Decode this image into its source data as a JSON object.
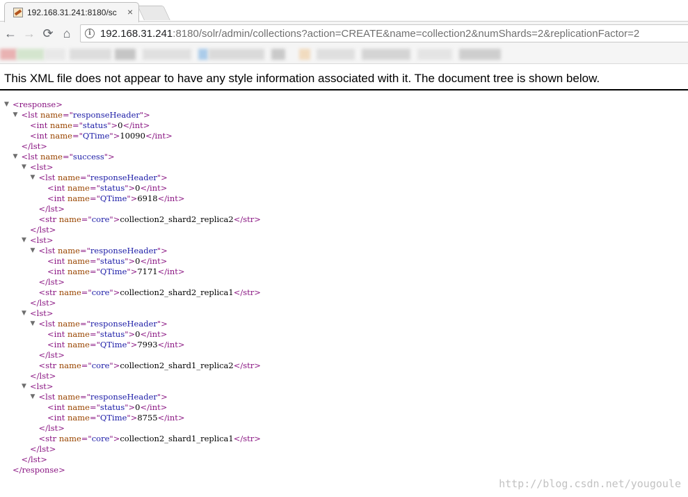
{
  "browser": {
    "tab": {
      "title": "192.168.31.241:8180/sc",
      "close_glyph": "×",
      "favicon": "solr-favicon"
    },
    "nav": {
      "back": "←",
      "forward": "→",
      "reload": "⟳",
      "home": "⌂"
    },
    "address": {
      "host": "192.168.31.241",
      "rest": ":8180/solr/admin/collections?action=CREATE&name=collection2&numShards=2&replicationFactor=2",
      "info_glyph": "i"
    }
  },
  "xml_viewer": {
    "header": "This XML file does not appear to have any style information associated with it. The document tree is shown below.",
    "toggle_glyph": "▼",
    "lines": [
      {
        "depth": 0,
        "toggle": true,
        "parts": [
          {
            "c": "tg",
            "t": "<response>"
          }
        ]
      },
      {
        "depth": 1,
        "toggle": true,
        "parts": [
          {
            "c": "tg",
            "t": "<lst "
          },
          {
            "c": "an",
            "t": "name"
          },
          {
            "c": "tg",
            "t": "=\""
          },
          {
            "c": "av",
            "t": "responseHeader"
          },
          {
            "c": "tg",
            "t": "\">"
          }
        ]
      },
      {
        "depth": 2,
        "toggle": false,
        "parts": [
          {
            "c": "tg",
            "t": "<int "
          },
          {
            "c": "an",
            "t": "name"
          },
          {
            "c": "tg",
            "t": "=\""
          },
          {
            "c": "av",
            "t": "status"
          },
          {
            "c": "tg",
            "t": "\">"
          },
          {
            "c": "tx",
            "t": "0"
          },
          {
            "c": "tg",
            "t": "</int>"
          }
        ]
      },
      {
        "depth": 2,
        "toggle": false,
        "parts": [
          {
            "c": "tg",
            "t": "<int "
          },
          {
            "c": "an",
            "t": "name"
          },
          {
            "c": "tg",
            "t": "=\""
          },
          {
            "c": "av",
            "t": "QTime"
          },
          {
            "c": "tg",
            "t": "\">"
          },
          {
            "c": "tx",
            "t": "10090"
          },
          {
            "c": "tg",
            "t": "</int>"
          }
        ]
      },
      {
        "depth": 1,
        "toggle": false,
        "parts": [
          {
            "c": "tg",
            "t": "</lst>"
          }
        ]
      },
      {
        "depth": 1,
        "toggle": true,
        "parts": [
          {
            "c": "tg",
            "t": "<lst "
          },
          {
            "c": "an",
            "t": "name"
          },
          {
            "c": "tg",
            "t": "=\""
          },
          {
            "c": "av",
            "t": "success"
          },
          {
            "c": "tg",
            "t": "\">"
          }
        ]
      },
      {
        "depth": 2,
        "toggle": true,
        "parts": [
          {
            "c": "tg",
            "t": "<lst>"
          }
        ]
      },
      {
        "depth": 3,
        "toggle": true,
        "parts": [
          {
            "c": "tg",
            "t": "<lst "
          },
          {
            "c": "an",
            "t": "name"
          },
          {
            "c": "tg",
            "t": "=\""
          },
          {
            "c": "av",
            "t": "responseHeader"
          },
          {
            "c": "tg",
            "t": "\">"
          }
        ]
      },
      {
        "depth": 4,
        "toggle": false,
        "parts": [
          {
            "c": "tg",
            "t": "<int "
          },
          {
            "c": "an",
            "t": "name"
          },
          {
            "c": "tg",
            "t": "=\""
          },
          {
            "c": "av",
            "t": "status"
          },
          {
            "c": "tg",
            "t": "\">"
          },
          {
            "c": "tx",
            "t": "0"
          },
          {
            "c": "tg",
            "t": "</int>"
          }
        ]
      },
      {
        "depth": 4,
        "toggle": false,
        "parts": [
          {
            "c": "tg",
            "t": "<int "
          },
          {
            "c": "an",
            "t": "name"
          },
          {
            "c": "tg",
            "t": "=\""
          },
          {
            "c": "av",
            "t": "QTime"
          },
          {
            "c": "tg",
            "t": "\">"
          },
          {
            "c": "tx",
            "t": "6918"
          },
          {
            "c": "tg",
            "t": "</int>"
          }
        ]
      },
      {
        "depth": 3,
        "toggle": false,
        "parts": [
          {
            "c": "tg",
            "t": "</lst>"
          }
        ]
      },
      {
        "depth": 3,
        "toggle": false,
        "parts": [
          {
            "c": "tg",
            "t": "<str "
          },
          {
            "c": "an",
            "t": "name"
          },
          {
            "c": "tg",
            "t": "=\""
          },
          {
            "c": "av",
            "t": "core"
          },
          {
            "c": "tg",
            "t": "\">"
          },
          {
            "c": "tx",
            "t": "collection2_shard2_replica2"
          },
          {
            "c": "tg",
            "t": "</str>"
          }
        ]
      },
      {
        "depth": 2,
        "toggle": false,
        "parts": [
          {
            "c": "tg",
            "t": "</lst>"
          }
        ]
      },
      {
        "depth": 2,
        "toggle": true,
        "parts": [
          {
            "c": "tg",
            "t": "<lst>"
          }
        ]
      },
      {
        "depth": 3,
        "toggle": true,
        "parts": [
          {
            "c": "tg",
            "t": "<lst "
          },
          {
            "c": "an",
            "t": "name"
          },
          {
            "c": "tg",
            "t": "=\""
          },
          {
            "c": "av",
            "t": "responseHeader"
          },
          {
            "c": "tg",
            "t": "\">"
          }
        ]
      },
      {
        "depth": 4,
        "toggle": false,
        "parts": [
          {
            "c": "tg",
            "t": "<int "
          },
          {
            "c": "an",
            "t": "name"
          },
          {
            "c": "tg",
            "t": "=\""
          },
          {
            "c": "av",
            "t": "status"
          },
          {
            "c": "tg",
            "t": "\">"
          },
          {
            "c": "tx",
            "t": "0"
          },
          {
            "c": "tg",
            "t": "</int>"
          }
        ]
      },
      {
        "depth": 4,
        "toggle": false,
        "parts": [
          {
            "c": "tg",
            "t": "<int "
          },
          {
            "c": "an",
            "t": "name"
          },
          {
            "c": "tg",
            "t": "=\""
          },
          {
            "c": "av",
            "t": "QTime"
          },
          {
            "c": "tg",
            "t": "\">"
          },
          {
            "c": "tx",
            "t": "7171"
          },
          {
            "c": "tg",
            "t": "</int>"
          }
        ]
      },
      {
        "depth": 3,
        "toggle": false,
        "parts": [
          {
            "c": "tg",
            "t": "</lst>"
          }
        ]
      },
      {
        "depth": 3,
        "toggle": false,
        "parts": [
          {
            "c": "tg",
            "t": "<str "
          },
          {
            "c": "an",
            "t": "name"
          },
          {
            "c": "tg",
            "t": "=\""
          },
          {
            "c": "av",
            "t": "core"
          },
          {
            "c": "tg",
            "t": "\">"
          },
          {
            "c": "tx",
            "t": "collection2_shard2_replica1"
          },
          {
            "c": "tg",
            "t": "</str>"
          }
        ]
      },
      {
        "depth": 2,
        "toggle": false,
        "parts": [
          {
            "c": "tg",
            "t": "</lst>"
          }
        ]
      },
      {
        "depth": 2,
        "toggle": true,
        "parts": [
          {
            "c": "tg",
            "t": "<lst>"
          }
        ]
      },
      {
        "depth": 3,
        "toggle": true,
        "parts": [
          {
            "c": "tg",
            "t": "<lst "
          },
          {
            "c": "an",
            "t": "name"
          },
          {
            "c": "tg",
            "t": "=\""
          },
          {
            "c": "av",
            "t": "responseHeader"
          },
          {
            "c": "tg",
            "t": "\">"
          }
        ]
      },
      {
        "depth": 4,
        "toggle": false,
        "parts": [
          {
            "c": "tg",
            "t": "<int "
          },
          {
            "c": "an",
            "t": "name"
          },
          {
            "c": "tg",
            "t": "=\""
          },
          {
            "c": "av",
            "t": "status"
          },
          {
            "c": "tg",
            "t": "\">"
          },
          {
            "c": "tx",
            "t": "0"
          },
          {
            "c": "tg",
            "t": "</int>"
          }
        ]
      },
      {
        "depth": 4,
        "toggle": false,
        "parts": [
          {
            "c": "tg",
            "t": "<int "
          },
          {
            "c": "an",
            "t": "name"
          },
          {
            "c": "tg",
            "t": "=\""
          },
          {
            "c": "av",
            "t": "QTime"
          },
          {
            "c": "tg",
            "t": "\">"
          },
          {
            "c": "tx",
            "t": "7993"
          },
          {
            "c": "tg",
            "t": "</int>"
          }
        ]
      },
      {
        "depth": 3,
        "toggle": false,
        "parts": [
          {
            "c": "tg",
            "t": "</lst>"
          }
        ]
      },
      {
        "depth": 3,
        "toggle": false,
        "parts": [
          {
            "c": "tg",
            "t": "<str "
          },
          {
            "c": "an",
            "t": "name"
          },
          {
            "c": "tg",
            "t": "=\""
          },
          {
            "c": "av",
            "t": "core"
          },
          {
            "c": "tg",
            "t": "\">"
          },
          {
            "c": "tx",
            "t": "collection2_shard1_replica2"
          },
          {
            "c": "tg",
            "t": "</str>"
          }
        ]
      },
      {
        "depth": 2,
        "toggle": false,
        "parts": [
          {
            "c": "tg",
            "t": "</lst>"
          }
        ]
      },
      {
        "depth": 2,
        "toggle": true,
        "parts": [
          {
            "c": "tg",
            "t": "<lst>"
          }
        ]
      },
      {
        "depth": 3,
        "toggle": true,
        "parts": [
          {
            "c": "tg",
            "t": "<lst "
          },
          {
            "c": "an",
            "t": "name"
          },
          {
            "c": "tg",
            "t": "=\""
          },
          {
            "c": "av",
            "t": "responseHeader"
          },
          {
            "c": "tg",
            "t": "\">"
          }
        ]
      },
      {
        "depth": 4,
        "toggle": false,
        "parts": [
          {
            "c": "tg",
            "t": "<int "
          },
          {
            "c": "an",
            "t": "name"
          },
          {
            "c": "tg",
            "t": "=\""
          },
          {
            "c": "av",
            "t": "status"
          },
          {
            "c": "tg",
            "t": "\">"
          },
          {
            "c": "tx",
            "t": "0"
          },
          {
            "c": "tg",
            "t": "</int>"
          }
        ]
      },
      {
        "depth": 4,
        "toggle": false,
        "parts": [
          {
            "c": "tg",
            "t": "<int "
          },
          {
            "c": "an",
            "t": "name"
          },
          {
            "c": "tg",
            "t": "=\""
          },
          {
            "c": "av",
            "t": "QTime"
          },
          {
            "c": "tg",
            "t": "\">"
          },
          {
            "c": "tx",
            "t": "8755"
          },
          {
            "c": "tg",
            "t": "</int>"
          }
        ]
      },
      {
        "depth": 3,
        "toggle": false,
        "parts": [
          {
            "c": "tg",
            "t": "</lst>"
          }
        ]
      },
      {
        "depth": 3,
        "toggle": false,
        "parts": [
          {
            "c": "tg",
            "t": "<str "
          },
          {
            "c": "an",
            "t": "name"
          },
          {
            "c": "tg",
            "t": "=\""
          },
          {
            "c": "av",
            "t": "core"
          },
          {
            "c": "tg",
            "t": "\">"
          },
          {
            "c": "tx",
            "t": "collection2_shard1_replica1"
          },
          {
            "c": "tg",
            "t": "</str>"
          }
        ]
      },
      {
        "depth": 2,
        "toggle": false,
        "parts": [
          {
            "c": "tg",
            "t": "</lst>"
          }
        ]
      },
      {
        "depth": 1,
        "toggle": false,
        "parts": [
          {
            "c": "tg",
            "t": "</lst>"
          }
        ]
      },
      {
        "depth": 0,
        "toggle": false,
        "parts": [
          {
            "c": "tg",
            "t": "</response>"
          }
        ]
      }
    ]
  },
  "watermark": "http://blog.csdn.net/yougoule",
  "colors": {
    "tag": "#881280",
    "attr_name": "#994500",
    "attr_value": "#1a1aa6",
    "text": "#000000"
  }
}
